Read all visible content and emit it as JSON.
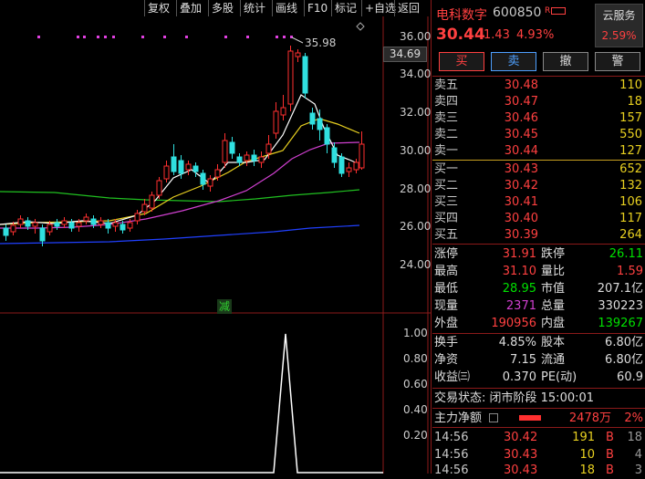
{
  "toolbar": [
    "复权",
    "叠加",
    "多股",
    "统计",
    "画线",
    "F10",
    "标记",
    "+自选",
    "返回"
  ],
  "chart": {
    "price_axis": [
      "36.00",
      "34.00",
      "32.00",
      "30.00",
      "28.00",
      "26.00",
      "24.00"
    ],
    "current_price_tag": "34.69",
    "high_label": "35.98",
    "reduce_mark": "减",
    "volume_axis": [
      "1.00",
      "0.80",
      "0.60",
      "0.40",
      "0.20"
    ]
  },
  "quote": {
    "name": "电科数字",
    "code": "600850",
    "r_tag": "R",
    "cloud_label": "云服务",
    "cloud_value": "2.59%",
    "price": "30.44",
    "change": "1.43",
    "change_pct": "4.93%",
    "actions": [
      "买",
      "卖",
      "撤",
      "警"
    ]
  },
  "asks": [
    {
      "label": "卖五",
      "price": "30.48",
      "vol": "110"
    },
    {
      "label": "卖四",
      "price": "30.47",
      "vol": "18"
    },
    {
      "label": "卖三",
      "price": "30.46",
      "vol": "157"
    },
    {
      "label": "卖二",
      "price": "30.45",
      "vol": "550"
    },
    {
      "label": "卖一",
      "price": "30.44",
      "vol": "127"
    }
  ],
  "bids": [
    {
      "label": "买一",
      "price": "30.43",
      "vol": "652"
    },
    {
      "label": "买二",
      "price": "30.42",
      "vol": "132"
    },
    {
      "label": "买三",
      "price": "30.41",
      "vol": "106"
    },
    {
      "label": "买四",
      "price": "30.40",
      "vol": "117"
    },
    {
      "label": "买五",
      "price": "30.39",
      "vol": "264"
    }
  ],
  "stats": {
    "limit_up_l": "涨停",
    "limit_up": "31.91",
    "limit_down_l": "跌停",
    "limit_down": "26.11",
    "high_l": "最高",
    "high": "31.10",
    "vol_ratio_l": "量比",
    "vol_ratio": "1.59",
    "low_l": "最低",
    "low": "28.95",
    "mcap_l": "市值",
    "mcap": "207.1亿",
    "cur_vol_l": "现量",
    "cur_vol": "2371",
    "total_vol_l": "总量",
    "total_vol": "330223",
    "outer_l": "外盘",
    "outer": "190956",
    "inner_l": "内盘",
    "inner": "139267",
    "turnover_l": "换手",
    "turnover": "4.85%",
    "equity_l": "股本",
    "equity": "6.80亿",
    "nav_l": "净资",
    "nav": "7.15",
    "float_l": "流通",
    "float": "6.80亿",
    "eps_l": "收益㈢",
    "eps": "0.370",
    "pe_l": "PE(动)",
    "pe": "60.9"
  },
  "status_line": "交易状态: 闭市阶段 15:00:01",
  "main_flow": {
    "label": "主力净额",
    "value": "2478万",
    "pct": "2%"
  },
  "ticks": [
    {
      "time": "14:56",
      "price": "30.42",
      "vol": "191",
      "side": "B",
      "n": "18"
    },
    {
      "time": "14:56",
      "price": "30.43",
      "vol": "10",
      "side": "B",
      "n": "4"
    },
    {
      "time": "14:56",
      "price": "30.43",
      "vol": "18",
      "side": "B",
      "n": "3"
    }
  ]
}
